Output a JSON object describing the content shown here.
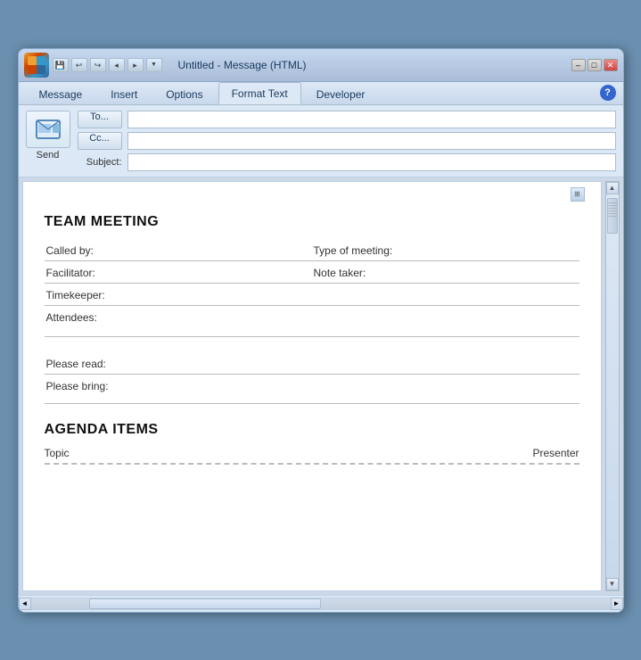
{
  "window": {
    "title": "Untitled - Message (HTML)",
    "logo_text": "O",
    "minimize": "–",
    "restore": "□",
    "close": "✕"
  },
  "quick_access": {
    "save": "💾",
    "undo": "↩",
    "redo": "↪",
    "prev": "◂",
    "next": "▸",
    "pin": "▾"
  },
  "tabs": [
    {
      "label": "Message",
      "active": false
    },
    {
      "label": "Insert",
      "active": false
    },
    {
      "label": "Options",
      "active": false
    },
    {
      "label": "Format Text",
      "active": true
    },
    {
      "label": "Developer",
      "active": false
    }
  ],
  "help_icon": "?",
  "email": {
    "send_icon": "✉",
    "send_label": "Send",
    "to_label": "To...",
    "cc_label": "Cc...",
    "subject_label": "Subject:",
    "to_value": "",
    "cc_value": "",
    "subject_value": ""
  },
  "body": {
    "team_meeting_title": "TEAM MEETING",
    "fields": [
      {
        "label": "Called by:",
        "right_label": "Type of meeting:",
        "full_width": false
      },
      {
        "label": "Facilitator:",
        "right_label": "Note taker:",
        "full_width": false
      },
      {
        "label": "Timekeeper:",
        "right_label": "",
        "full_width": true
      },
      {
        "label": "Attendees:",
        "right_label": "",
        "full_width": true
      }
    ],
    "spacer": true,
    "extra_fields": [
      {
        "label": "Please read:",
        "full_width": true
      },
      {
        "label": "Please bring:",
        "full_width": true
      }
    ],
    "agenda_title": "AGENDA ITEMS",
    "agenda_columns": [
      {
        "label": "Topic"
      },
      {
        "label": "Presenter"
      }
    ]
  },
  "scrollbar": {
    "up_arrow": "▲",
    "down_arrow": "▼",
    "left_arrow": "◄",
    "right_arrow": "►"
  }
}
